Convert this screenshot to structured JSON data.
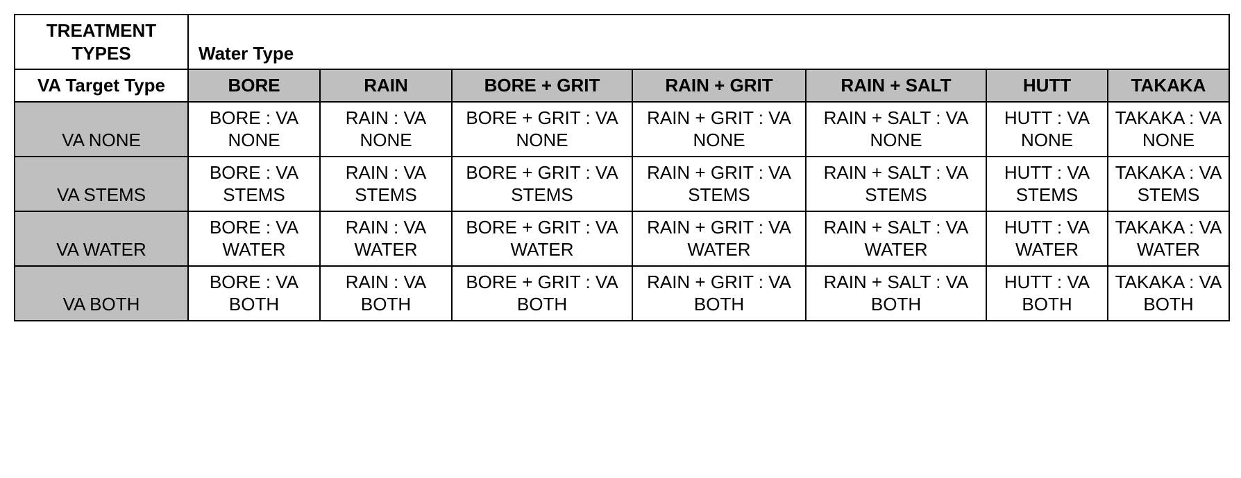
{
  "chart_data": {
    "type": "table",
    "corner_label": "TREATMENT TYPES",
    "col_axis_label": "Water Type",
    "row_axis_label": "VA Target Type",
    "columns": [
      "BORE",
      "RAIN",
      "BORE + GRIT",
      "RAIN + GRIT",
      "RAIN + SALT",
      "HUTT",
      "TAKAKA"
    ],
    "rows": [
      "VA NONE",
      "VA STEMS",
      "VA WATER",
      "VA BOTH"
    ],
    "cells": [
      [
        "BORE : VA NONE",
        "RAIN : VA NONE",
        "BORE + GRIT : VA NONE",
        "RAIN + GRIT : VA NONE",
        "RAIN + SALT : VA NONE",
        "HUTT : VA NONE",
        "TAKAKA : VA NONE"
      ],
      [
        "BORE : VA STEMS",
        "RAIN : VA STEMS",
        "BORE + GRIT : VA STEMS",
        "RAIN + GRIT : VA STEMS",
        "RAIN + SALT : VA STEMS",
        "HUTT : VA STEMS",
        "TAKAKA : VA STEMS"
      ],
      [
        "BORE : VA WATER",
        "RAIN : VA WATER",
        "BORE + GRIT : VA WATER",
        "RAIN + GRIT : VA WATER",
        "RAIN + SALT : VA WATER",
        "HUTT : VA WATER",
        "TAKAKA : VA WATER"
      ],
      [
        "BORE : VA BOTH",
        "RAIN : VA BOTH",
        "BORE + GRIT : VA BOTH",
        "RAIN + GRIT : VA BOTH",
        "RAIN + SALT : VA BOTH",
        "HUTT : VA BOTH",
        "TAKAKA : VA BOTH"
      ]
    ]
  }
}
